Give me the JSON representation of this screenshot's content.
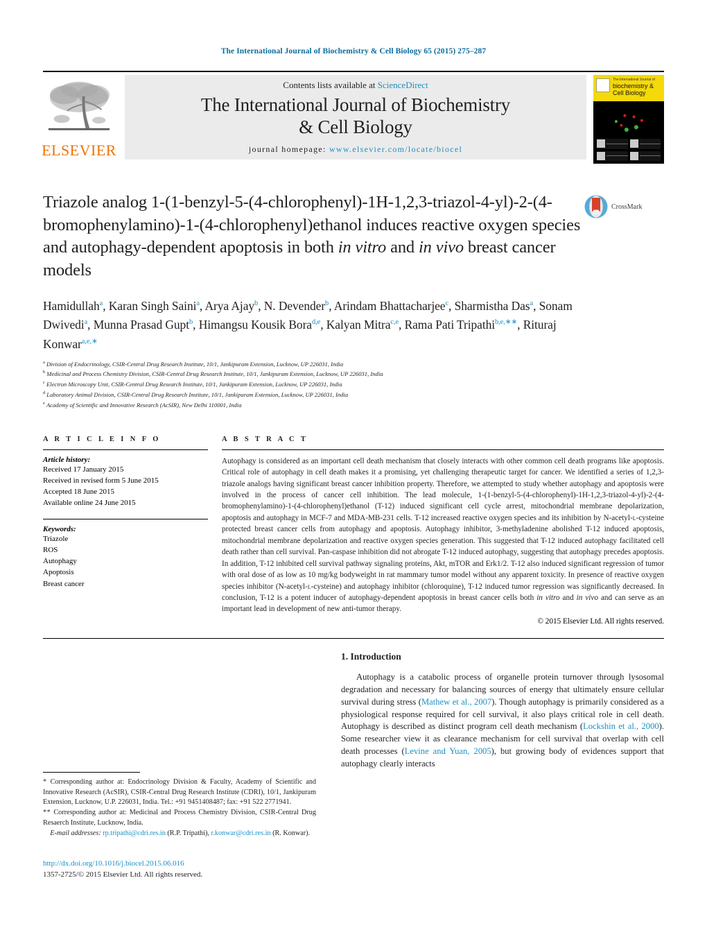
{
  "running_head": "The International Journal of Biochemistry & Cell Biology 65 (2015) 275–287",
  "masthead": {
    "publisher_name": "ELSEVIER",
    "contents_prefix": "Contents lists available at ",
    "contents_link": "ScienceDirect",
    "journal_title_line1": "The International Journal of Biochemistry",
    "journal_title_line2": "& Cell Biology",
    "homepage_label": "journal homepage: ",
    "homepage_url": "www.elsevier.com/locate/biocel",
    "cover_title_small": "The International Journal of",
    "cover_title_big": "biochemistry & Cell Biology"
  },
  "article": {
    "title_html": "Triazole analog 1-(1-benzyl-5-(4-chlorophenyl)-1H-1,2,3-triazol-4-yl)-2-(4-bromophenylamino)-1-(4-chlorophenyl)ethanol induces reactive oxygen species and autophagy-dependent apoptosis in both <em>in vitro</em> and <em>in vivo</em> breast cancer models",
    "crossmark_label": "CrossMark",
    "authors_html": "Hamidullah<sup>a</sup>, Karan Singh Saini<sup>a</sup>, Arya Ajay<sup>b</sup>, N. Devender<sup>b</sup>, Arindam Bhattacharjee<sup>c</sup>, Sharmistha Das<sup>a</sup>, Sonam Dwivedi<sup>a</sup>, Munna Prasad Gupt<sup>b</sup>, Himangsu Kousik Bora<sup>d,e</sup>, Kalyan Mitra<sup>c,e</sup>, Rama Pati Tripathi<sup>b,e,∗∗</sup>, Rituraj Konwar<sup>a,e,∗</sup>",
    "affiliations": [
      {
        "sup": "a",
        "text": "Division of Endocrinology, CSIR-Central Drug Research Institute, 10/1, Jankipuram Extension, Lucknow, UP 226031, India"
      },
      {
        "sup": "b",
        "text": "Medicinal and Process Chemistry Division, CSIR-Central Drug Research Institute, 10/1, Jankipuram Extension, Lucknow, UP 226031, India"
      },
      {
        "sup": "c",
        "text": "Electron Microscopy Unit, CSIR-Central Drug Research Institute, 10/1, Jankipuram Extension, Lucknow, UP 226031, India"
      },
      {
        "sup": "d",
        "text": "Laboratory Animal Division, CSIR-Central Drug Research Institute, 10/1, Jankipuram Extension, Lucknow, UP 226031, India"
      },
      {
        "sup": "e",
        "text": "Academy of Scientific and Innovative Research (AcSIR), New Delhi 110001, India"
      }
    ]
  },
  "article_info": {
    "heading": "A R T I C L E   I N F O",
    "history_label": "Article history:",
    "history": [
      "Received 17 January 2015",
      "Received in revised form 5 June 2015",
      "Accepted 18 June 2015",
      "Available online 24 June 2015"
    ],
    "keywords_label": "Keywords:",
    "keywords": [
      "Triazole",
      "ROS",
      "Autophagy",
      "Apoptosis",
      "Breast cancer"
    ]
  },
  "abstract": {
    "heading": "A B S T R A C T",
    "text_html": "Autophagy is considered as an important cell death mechanism that closely interacts with other common cell death programs like apoptosis. Critical role of autophagy in cell death makes it a promising, yet challenging therapeutic target for cancer. We identified a series of 1,2,3-triazole analogs having significant breast cancer inhibition property. Therefore, we attempted to study whether autophagy and apoptosis were involved in the process of cancer cell inhibition. The lead molecule, 1-(1-benzyl-5-(4-chlorophenyl)-1H-1,2,3-triazol-4-yl)-2-(4-bromophenylamino)-1-(4-chlorophenyl)ethanol (T-12) induced significant cell cycle arrest, mitochondrial membrane depolarization, apoptosis and autophagy in MCF-7 and MDA-MB-231 cells. T-12 increased reactive oxygen species and its inhibition by N-acetyl-<span style=\"font-variant:small-caps\">l</span>-cysteine protected breast cancer cells from autophagy and apoptosis. Autophagy inhibitor, 3-methyladenine abolished T-12 induced apoptosis, mitochondrial membrane depolarization and reactive oxygen species generation. This suggested that T-12 induced autophagy facilitated cell death rather than cell survival. Pan-caspase inhibition did not abrogate T-12 induced autophagy, suggesting that autophagy precedes apoptosis. In addition, T-12 inhibited cell survival pathway signaling proteins, Akt, mTOR and Erk1/2. T-12 also induced significant regression of tumor with oral dose of as low as 10 mg/kg bodyweight in rat mammary tumor model without any apparent toxicity. In presence of reactive oxygen species inhibitor (N-acetyl-<span style=\"font-variant:small-caps\">l</span>-cysteine) and autophagy inhibitor (chloroquine), T-12 induced tumor regression was significantly decreased. In conclusion, T-12 is a potent inducer of autophagy-dependent apoptosis in breast cancer cells both <em>in vitro</em> and <em>in vivo</em> and can serve as an important lead in development of new anti-tumor therapy.",
    "copyright": "© 2015 Elsevier Ltd. All rights reserved."
  },
  "introduction": {
    "heading": "1. Introduction",
    "paragraph_html": "Autophagy is a catabolic process of organelle protein turnover through lysosomal degradation and necessary for balancing sources of energy that ultimately ensure cellular survival during stress (<span class=\"lnk\">Mathew et al., 2007</span>). Though autophagy is primarily considered as a physiological response required for cell survival, it also plays critical role in cell death. Autophagy is described as distinct program cell death mechanism (<span class=\"lnk\">Lockshin et al., 2000</span>). Some researcher view it as clearance mechanism for cell survival that overlap with cell death processes (<span class=\"lnk\">Levine and Yuan, 2005</span>), but growing body of evidences support that autophagy clearly interacts"
  },
  "footnotes": {
    "note1_html": "<span class=\"star\">*</span> Corresponding author at: Endocrinology Division &amp; Faculty, Academy of Scientific and Innovative Research (AcSIR), CSIR-Central Drug Research Institute (CDRI), 10/1, Jankipuram Extension, Lucknow, U.P. 226031, India. Tel.: +91 9451408487; fax: +91 522 2771941.",
    "note2_html": "<span class=\"star\">**</span> Corresponding author at: Medicinal and Process Chemistry Division, CSIR-Central Drug Resaerch Institute, Lucknow, India.",
    "email_label": "E-mail addresses:",
    "email1": "rp.tripathi@cdri.res.in",
    "email1_person": "(R.P. Tripathi)",
    "email2": "r.konwar@cdri.res.in",
    "email2_person": "(R. Konwar)."
  },
  "footer": {
    "doi_url": "http://dx.doi.org/10.1016/j.biocel.2015.06.016",
    "issn_line": "1357-2725/© 2015 Elsevier Ltd. All rights reserved."
  },
  "colors": {
    "link_blue": "#1b8fc4",
    "elsevier_orange": "#ec7404",
    "masthead_grey": "#ebebeb",
    "cover_yellow": "#f5d90a"
  }
}
